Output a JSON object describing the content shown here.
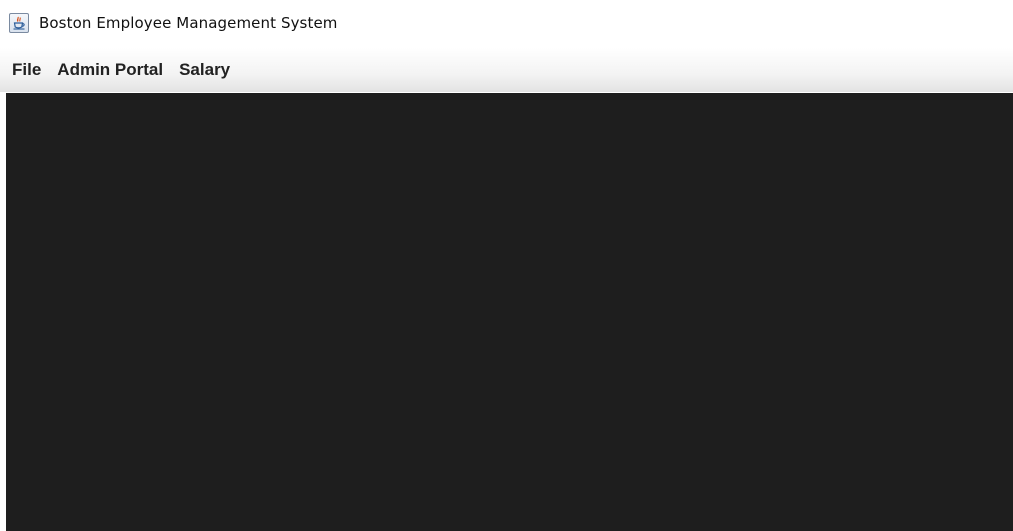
{
  "window": {
    "title": "Boston Employee Management System",
    "icon": "java-coffee-cup-icon"
  },
  "menubar": {
    "items": [
      {
        "label": "File"
      },
      {
        "label": "Admin Portal"
      },
      {
        "label": "Salary"
      }
    ]
  },
  "colors": {
    "content_background": "#1e1e1e",
    "menubar_text": "#222222"
  }
}
